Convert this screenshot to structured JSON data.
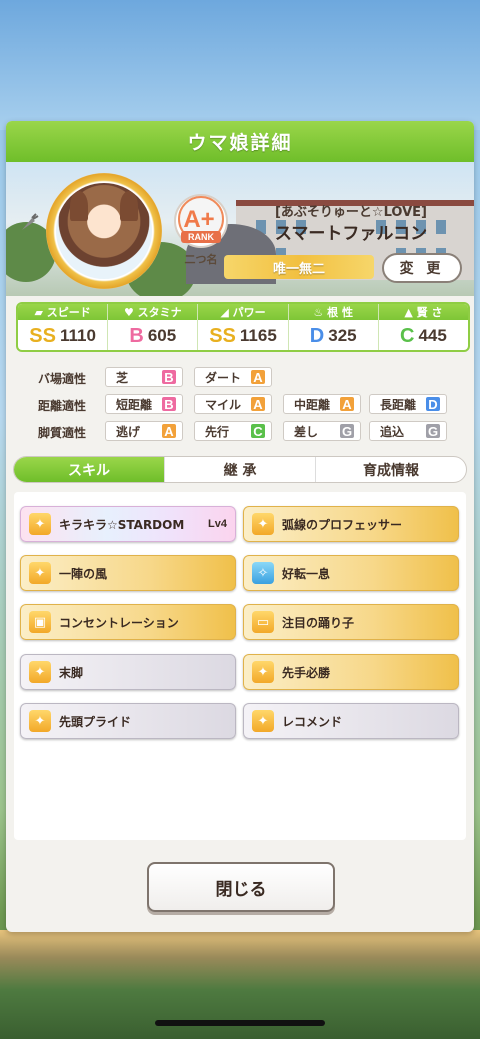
{
  "header": {
    "title": "ウマ娘詳細"
  },
  "profile": {
    "rank_label": "RANK",
    "rank_grade": "A+",
    "rank_sub": "二つ名",
    "title": "[あぶそりゅーと☆LOVE]",
    "name": "スマートファルコン",
    "epithet": "唯一無二",
    "change_label": "変 更"
  },
  "stats": [
    {
      "label": "スピード",
      "icon": "shoe-icon",
      "grade": "SS",
      "value": "1110",
      "color": "#e8b020"
    },
    {
      "label": "スタミナ",
      "icon": "heart-icon",
      "grade": "B",
      "value": "605",
      "color": "#ee6aa0"
    },
    {
      "label": "パワー",
      "icon": "muscle-icon",
      "grade": "SS",
      "value": "1165",
      "color": "#e8b020"
    },
    {
      "label": "根 性",
      "icon": "flame-icon",
      "grade": "D",
      "value": "325",
      "color": "#4a8ee8"
    },
    {
      "label": "賢 さ",
      "icon": "graduation-cap-icon",
      "grade": "C",
      "value": "445",
      "color": "#5ac04a"
    }
  ],
  "aptitude": {
    "track": {
      "label": "バ場適性",
      "items": [
        {
          "name": "芝",
          "grade": "B"
        },
        {
          "name": "ダート",
          "grade": "A"
        }
      ]
    },
    "distance": {
      "label": "距離適性",
      "items": [
        {
          "name": "短距離",
          "grade": "B"
        },
        {
          "name": "マイル",
          "grade": "A"
        },
        {
          "name": "中距離",
          "grade": "A"
        },
        {
          "name": "長距離",
          "grade": "D"
        }
      ]
    },
    "style": {
      "label": "脚質適性",
      "items": [
        {
          "name": "逃げ",
          "grade": "A"
        },
        {
          "name": "先行",
          "grade": "C"
        },
        {
          "name": "差し",
          "grade": "G"
        },
        {
          "name": "追込",
          "grade": "G"
        }
      ]
    }
  },
  "grade_colors": {
    "A": "#f2a13a",
    "B": "#ee6aa0",
    "C": "#5ac04a",
    "D": "#4a8ee8",
    "G": "#a0a0a8"
  },
  "tabs": [
    {
      "label": "スキル"
    },
    {
      "label": "継 承"
    },
    {
      "label": "育成情報"
    }
  ],
  "skills": [
    {
      "name": "キラキラ☆STARDOM",
      "level": "Lv4",
      "style": "rainbow"
    },
    {
      "name": "弧線のプロフェッサー",
      "style": "gold"
    },
    {
      "name": "一陣の風",
      "style": "gold"
    },
    {
      "name": "好転一息",
      "style": "gold",
      "icon": "sparkle"
    },
    {
      "name": "コンセントレーション",
      "style": "gold"
    },
    {
      "name": "注目の踊り子",
      "style": "gold"
    },
    {
      "name": "末脚",
      "style": "grey"
    },
    {
      "name": "先手必勝",
      "style": "gold"
    },
    {
      "name": "先頭プライド",
      "style": "grey"
    },
    {
      "name": "レコメンド",
      "style": "grey"
    }
  ],
  "footer": {
    "close_label": "閉じる"
  }
}
